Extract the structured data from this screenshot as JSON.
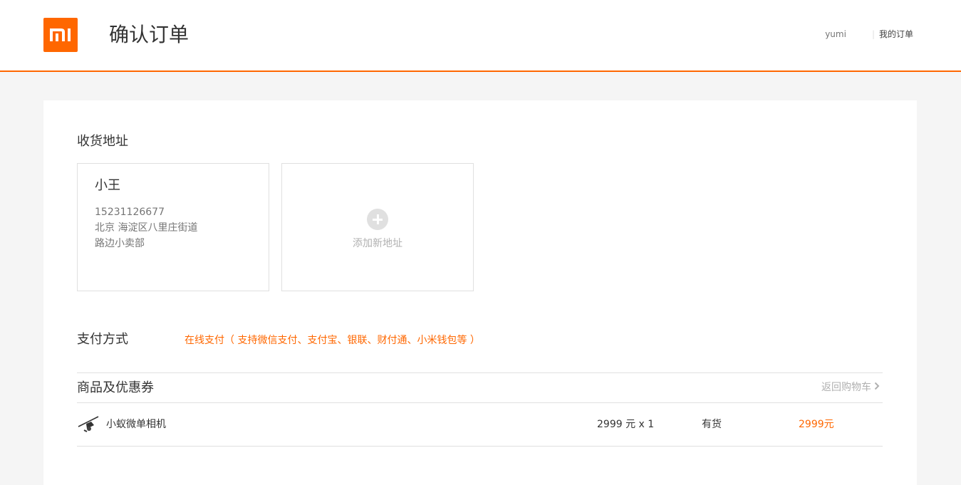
{
  "header": {
    "logo_icon": "mi-logo-icon",
    "title": "确认订单",
    "user": "yumi",
    "my_orders": "我的订单"
  },
  "address": {
    "section_title": "收货地址",
    "card": {
      "name": "小王",
      "phone": "15231126677",
      "line1": "北京 海淀区八里庄街道",
      "line2": "路边小卖部"
    },
    "add_new": "添加新地址"
  },
  "payment": {
    "section_title": "支付方式",
    "value": "在线支付（ 支持微信支付、支付宝、银联、财付通、小米钱包等 ）"
  },
  "items": {
    "section_title": "商品及优惠券",
    "back_to_cart": "返回购物车",
    "rows": [
      {
        "name": "小蚁微单相机",
        "price_qty": "2999 元 x 1",
        "stock": "有货",
        "total": "2999元"
      }
    ]
  },
  "colors": {
    "accent": "#ff6700",
    "background": "#f5f5f5",
    "border": "#e0e0e0"
  }
}
